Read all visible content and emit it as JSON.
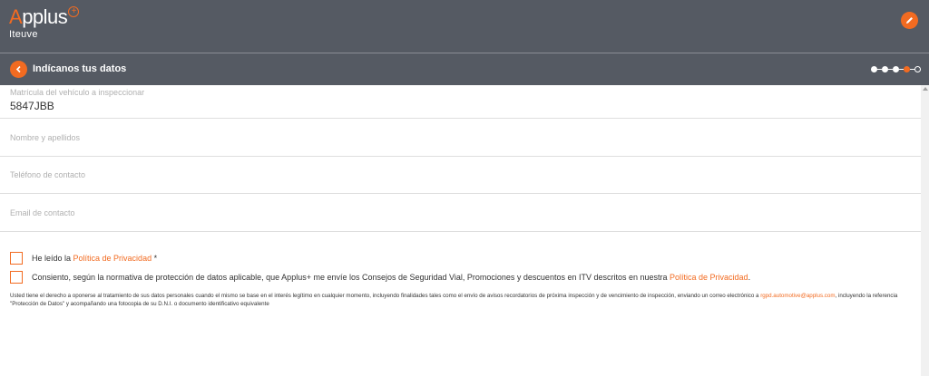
{
  "brand": {
    "name_a": "A",
    "name_rest": "pplus",
    "plus": "+",
    "sub": "Iteuve",
    "accent": "#f26b21"
  },
  "header": {
    "title": "Indícanos tus datos",
    "steps_total": 5,
    "step_current": 4
  },
  "form": {
    "plate": {
      "label": "Matrícula del vehículo a inspeccionar",
      "value": "5847JBB"
    },
    "name": {
      "placeholder": "Nombre y apellidos"
    },
    "phone": {
      "placeholder": "Teléfono de contacto"
    },
    "email": {
      "placeholder": "Email de contacto"
    }
  },
  "consents": {
    "privacy": {
      "text": "He leído la ",
      "link": "Política de Privacidad",
      "suffix": " *"
    },
    "marketing": {
      "text": "Consiento, según la normativa de protección de datos aplicable, que Applus+ me envíe los Consejos de Seguridad Vial, Promociones y descuentos en ITV descritos en nuestra ",
      "link": "Política de Privacidad",
      "suffix": "."
    }
  },
  "legal": {
    "text1": "Usted tiene el derecho a oponerse al tratamiento de sus datos personales cuando el mismo se base en el interés legítimo en cualquier momento, incluyendo finalidades tales como el envío de avisos recordatorios de próxima inspección y de vencimiento de inspección, enviando un correo electrónico a ",
    "email": "rgpd.automotive@applus.com",
    "text2": ", incluyendo la referencia \"Protección de Datos\" y acompañando una fotocopia de su D.N.I. o documento identificativo equivalente"
  },
  "icons": {
    "edit": "pencil-icon",
    "back": "chevron-left-icon"
  }
}
